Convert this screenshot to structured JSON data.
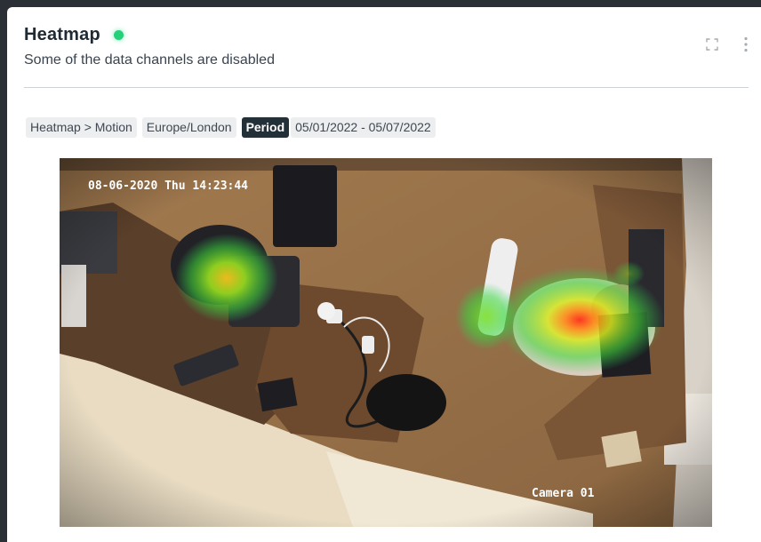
{
  "header": {
    "title": "Heatmap",
    "subtitle": "Some of the data channels are disabled",
    "status_color": "#22d17a"
  },
  "filters": {
    "chips": [
      {
        "label": "Heatmap > Motion"
      },
      {
        "label": "Europe/London"
      }
    ],
    "period_label": "Period",
    "period_range": "05/01/2022 - 05/07/2022"
  },
  "camera": {
    "timestamp": "08-06-2020 Thu 14:23:44",
    "name": "Camera 01"
  },
  "icons": {
    "expand": "expand-icon",
    "more": "more-vertical-icon"
  }
}
